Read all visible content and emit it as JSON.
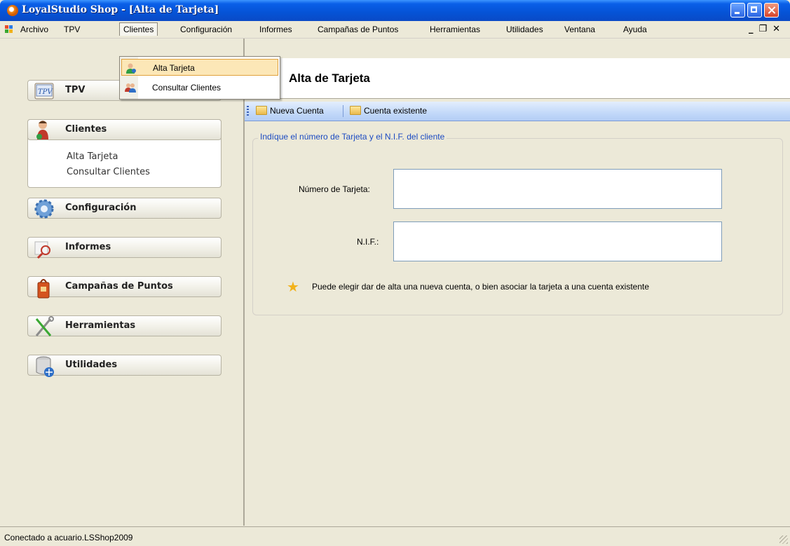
{
  "window": {
    "title": "LoyalStudio Shop - [Alta de Tarjeta]"
  },
  "menubar": {
    "items": [
      "Archivo",
      "TPV",
      "Clientes",
      "Configuración",
      "Informes",
      "Campañas de Puntos",
      "Herramientas",
      "Utilidades",
      "Ventana",
      "Ayuda"
    ],
    "active": "Clientes"
  },
  "dropdown": {
    "items": [
      "Alta Tarjeta",
      "Consultar Clientes"
    ],
    "highlighted": "Alta Tarjeta"
  },
  "sidebar": {
    "sections": [
      {
        "label": "TPV",
        "icon": "tpv-icon"
      },
      {
        "label": "Clientes",
        "icon": "clientes-icon",
        "links": [
          "Alta Tarjeta",
          "Consultar Clientes"
        ]
      },
      {
        "label": "Configuración",
        "icon": "gear-icon"
      },
      {
        "label": "Informes",
        "icon": "magnifier-icon"
      },
      {
        "label": "Campañas de Puntos",
        "icon": "bag-icon"
      },
      {
        "label": "Herramientas",
        "icon": "tools-icon"
      },
      {
        "label": "Utilidades",
        "icon": "database-icon"
      }
    ]
  },
  "content": {
    "title": "Alta de Tarjeta",
    "toolbar": {
      "nueva_cuenta": "Nueva Cuenta",
      "cuenta_existente": "Cuenta existente"
    },
    "group_legend": "Indíque el número de Tarjeta y el N.I.F. del cliente",
    "fields": {
      "numero_label": "Número de Tarjeta:",
      "numero_value": "",
      "nif_label": "N.I.F.:",
      "nif_value": ""
    },
    "info": "Puede elegir dar de alta una nueva cuenta, o bien asociar la tarjeta a una cuenta existente"
  },
  "status": {
    "text": "Conectado a acuario.LSShop2009"
  },
  "colors": {
    "titlebar": "#0553d6",
    "legend": "#1c4bc2",
    "highlight": "#fce7b7",
    "window_bg": "#ece9d8"
  }
}
